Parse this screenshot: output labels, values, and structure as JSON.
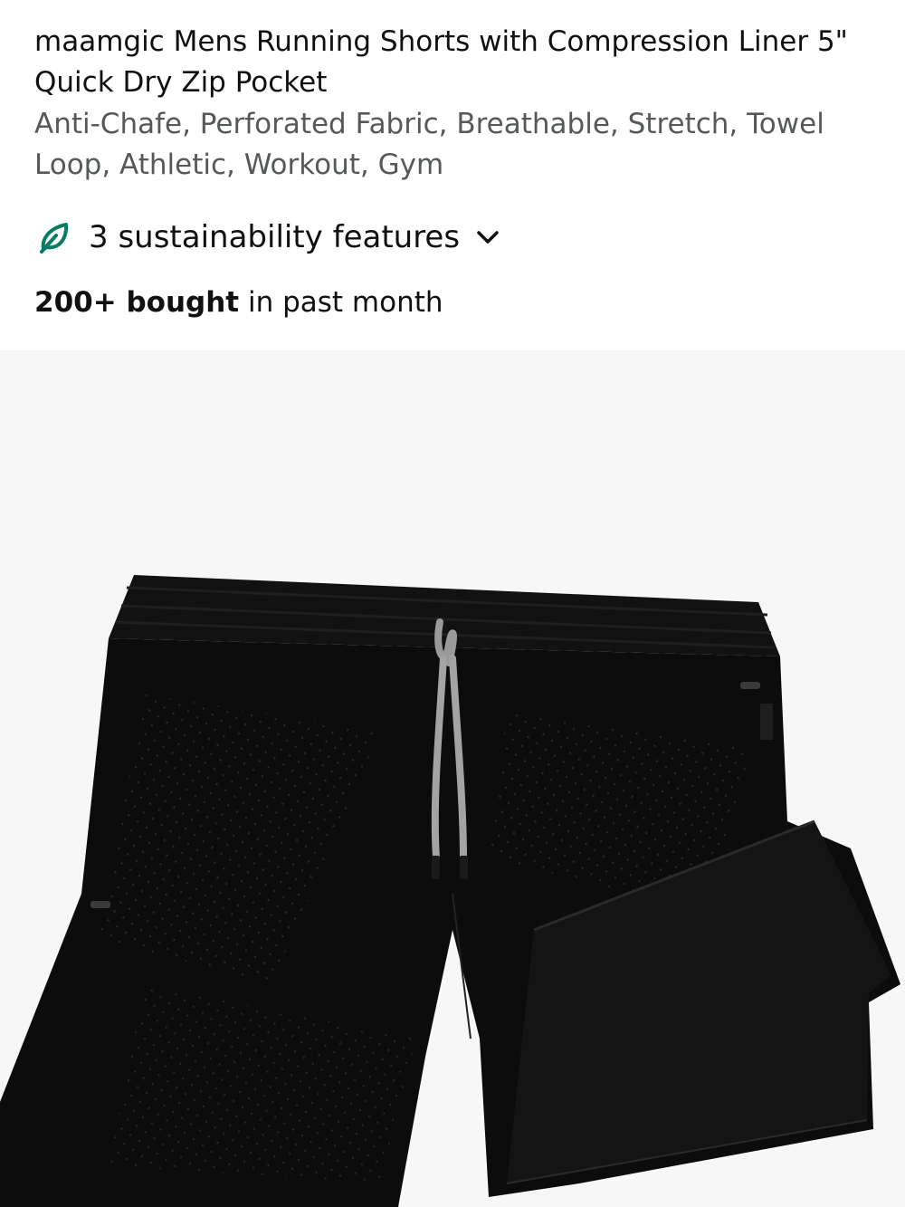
{
  "product": {
    "title": "maamgic Mens Running Shorts with Compression Liner 5\" Quick Dry Zip Pocket",
    "subtitle": "Anti-Chafe, Perforated Fabric, Breathable, Stretch, Towel Loop, Athletic, Workout, Gym",
    "sustainability": {
      "label": "3 sustainability features",
      "icon": "leaf-icon",
      "expand_icon": "chevron-down-icon",
      "accent_color": "#067d62"
    },
    "social_proof": {
      "count": "200+ bought",
      "suffix": " in past month"
    },
    "image": {
      "alt": "maamgic Mens Running Shorts",
      "background": "#f7f7f7",
      "brand_tag": "maamgic"
    }
  }
}
